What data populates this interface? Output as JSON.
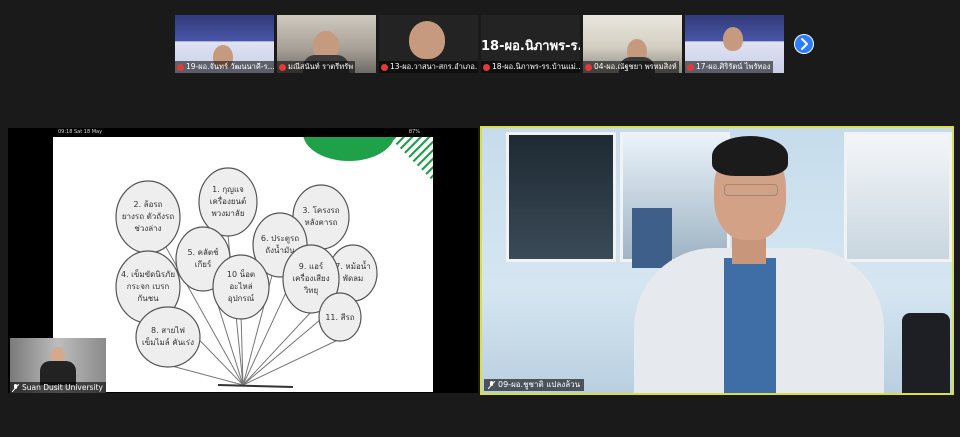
{
  "participants": [
    {
      "name": "19-ผอ.จันทร์ วัฒนนาคี-ร...",
      "muted": true,
      "view": "slide"
    },
    {
      "name": "มณีสนันท์ ราตรีทรัพ",
      "muted": true,
      "view": "room"
    },
    {
      "name": "13-ผอ.วาสนา-สกร.อำเภอ...",
      "muted": true,
      "view": "dark"
    },
    {
      "name": "18-ผอ.นิภาพร-รร.บ้านแม่...",
      "muted": true,
      "view": "name",
      "big_label": "18-ผอ.นิภาพร-ร..."
    },
    {
      "name": "04-ผอ.ณัฐชยา พรหมสิงห์",
      "muted": true,
      "view": "office"
    },
    {
      "name": "17-ผอ.ศิริรัตน์ ไพรัทอง",
      "muted": true,
      "view": "slide"
    }
  ],
  "share": {
    "status_left": "09:18   Sat 18 May",
    "status_right": "87%",
    "balloons": [
      {
        "id": "b1",
        "lines": [
          "1. กุญแจ",
          "เครื่องยนต์",
          "พวงมาลัย"
        ]
      },
      {
        "id": "b2",
        "lines": [
          "2. ล้อรถ",
          "ยางรถ ตัวถังรถ",
          "ช่วงล่าง"
        ]
      },
      {
        "id": "b3",
        "lines": [
          "3. โครงรถ",
          "หลังคารถ"
        ]
      },
      {
        "id": "b4",
        "lines": [
          "4. เข็มขัดนิรภัย",
          "กระจก เบรก",
          "กันชน"
        ]
      },
      {
        "id": "b5",
        "lines": [
          "5. คลัตช์",
          "เกียร์"
        ]
      },
      {
        "id": "b6",
        "lines": [
          "6. ประตูรถ",
          "ถังน้ำมัน"
        ]
      },
      {
        "id": "b7",
        "lines": [
          "7. หม้อน้ำ",
          "พัดลม"
        ]
      },
      {
        "id": "b8",
        "lines": [
          "8. สายไฟ",
          "เข็มไมล์ คันเร่ง"
        ]
      },
      {
        "id": "b9",
        "lines": [
          "9. แอร์",
          "เครื่องเสียง",
          "วิทยุ"
        ]
      },
      {
        "id": "b10",
        "lines": [
          "10 น็อต",
          "อะไหล่",
          "อุปกรณ์"
        ]
      },
      {
        "id": "b11",
        "lines": [
          "11. สีรถ"
        ]
      }
    ]
  },
  "self_view": {
    "name": "Suan Dusit University",
    "muted": true
  },
  "active_speaker": {
    "name": "09-ผอ.ชูชาติ แปลงล้วน",
    "muted": true
  },
  "colors": {
    "active_border": "#d6e04a",
    "mute_red": "#e03b3b",
    "slide_green": "#1fa14a"
  }
}
